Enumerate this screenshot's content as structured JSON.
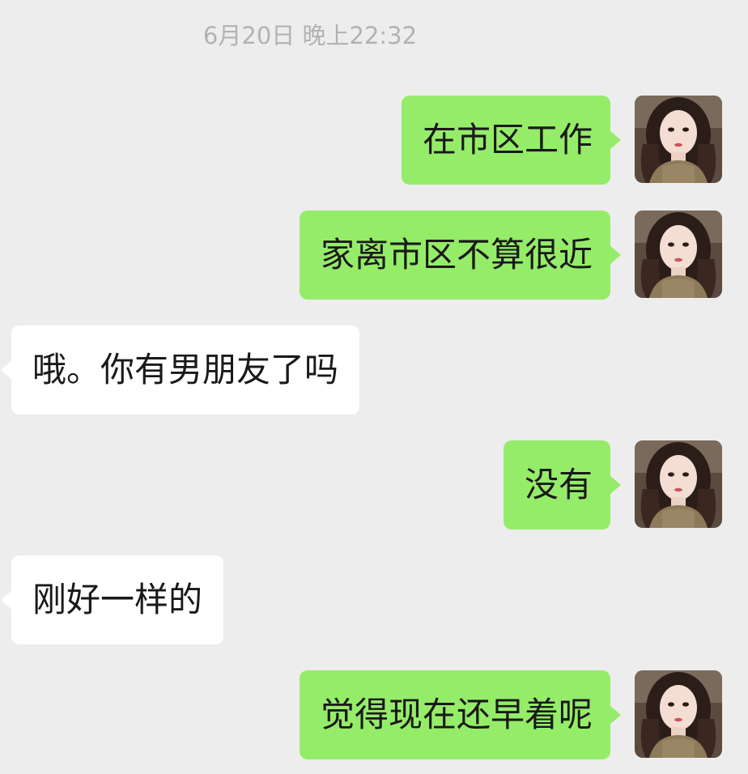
{
  "chat": {
    "timestamp": "6月20日 晚上22:32",
    "messages": [
      {
        "sender": "me",
        "text": "在市区工作"
      },
      {
        "sender": "me",
        "text": "家离市区不算很近"
      },
      {
        "sender": "other",
        "text": "哦。你有男朋友了吗"
      },
      {
        "sender": "me",
        "text": "没有"
      },
      {
        "sender": "other",
        "text": "刚好一样的"
      },
      {
        "sender": "me",
        "text": "觉得现在还早着呢"
      }
    ]
  },
  "colors": {
    "background": "#ededed",
    "my_bubble": "#95ec69",
    "other_bubble": "#ffffff",
    "timestamp_text": "#b2b2b2",
    "message_text": "#191919"
  },
  "icons": {
    "avatar": "user-avatar-photo"
  }
}
